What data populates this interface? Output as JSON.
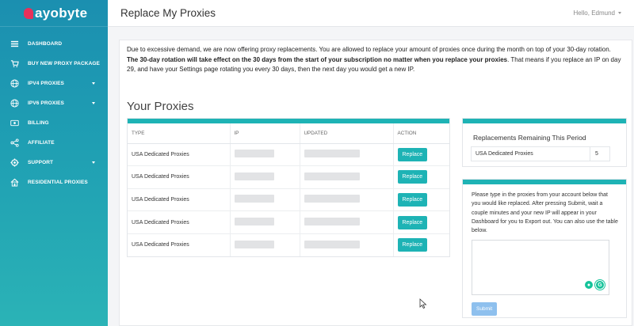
{
  "brand": {
    "logo_text": "ayobyte"
  },
  "header": {
    "title": "Replace My Proxies",
    "greeting": "Hello, Edmund"
  },
  "sidebar": {
    "items": [
      {
        "label": "DASHBOARD",
        "icon": "dashboard-icon",
        "has_caret": false
      },
      {
        "label": "BUY NEW PROXY PACKAGE",
        "icon": "cart-icon",
        "has_caret": false
      },
      {
        "label": "IPV4 PROXIES",
        "icon": "globe-icon",
        "has_caret": true
      },
      {
        "label": "IPV6 PROXIES",
        "icon": "globe-icon",
        "has_caret": true
      },
      {
        "label": "BILLING",
        "icon": "billing-icon",
        "has_caret": false
      },
      {
        "label": "AFFILIATE",
        "icon": "share-icon",
        "has_caret": false
      },
      {
        "label": "SUPPORT",
        "icon": "support-icon",
        "has_caret": true
      },
      {
        "label": "RESIDENTIAL PROXIES",
        "icon": "home-icon",
        "has_caret": false
      }
    ]
  },
  "intro": {
    "line1": "Due to excessive demand, we are now offering proxy replacements. You are allowed to replace your amount of proxies once during the month on top of your 30-day rotation.",
    "bold": "The 30-day rotation will take effect on the 30 days from the start of your subscription no matter when you replace your proxies",
    "line2": ". That means if you replace an IP on day 29, and have your Settings page rotating you every 30 days, then the next day you would get a new IP."
  },
  "proxies": {
    "title": "Your Proxies",
    "columns": [
      "TYPE",
      "IP",
      "UPDATED",
      "ACTION"
    ],
    "rows": [
      {
        "type": "USA Dedicated Proxies",
        "action": "Replace"
      },
      {
        "type": "USA Dedicated Proxies",
        "action": "Replace"
      },
      {
        "type": "USA Dedicated Proxies",
        "action": "Replace"
      },
      {
        "type": "USA Dedicated Proxies",
        "action": "Replace"
      },
      {
        "type": "USA Dedicated Proxies",
        "action": "Replace"
      }
    ]
  },
  "remaining": {
    "title": "Replacements Remaining This Period",
    "label": "USA Dedicated Proxies",
    "value": "5"
  },
  "submit_card": {
    "instructions": "Please type in the proxies from your account below that you would like replaced. After pressing Submit, wait a couple minutes and your new IP will appear in your Dashboard for you to Export out. You can also use the table below.",
    "textarea_value": "",
    "submit_label": "Submit"
  },
  "colors": {
    "accent": "#1eb3b5",
    "logo_mark": "#e8305a",
    "submit": "#8ec0ee",
    "grammarly": "#15c39a"
  }
}
